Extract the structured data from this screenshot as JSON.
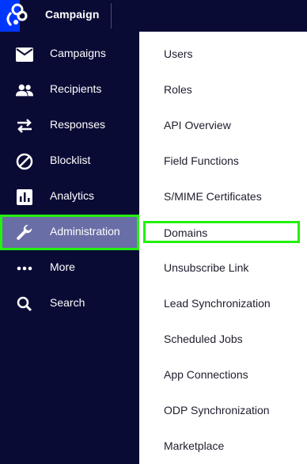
{
  "header": {
    "app_name": "Campaign"
  },
  "sidebar": {
    "items": [
      {
        "label": "Campaigns",
        "icon": "mail-icon"
      },
      {
        "label": "Recipients",
        "icon": "people-icon"
      },
      {
        "label": "Responses",
        "icon": "swap-arrows-icon"
      },
      {
        "label": "Blocklist",
        "icon": "block-icon"
      },
      {
        "label": "Analytics",
        "icon": "bar-chart-icon"
      },
      {
        "label": "Administration",
        "icon": "wrench-icon",
        "active": true
      },
      {
        "label": "More",
        "icon": "more-dots-icon"
      },
      {
        "label": "Search",
        "icon": "search-icon"
      }
    ]
  },
  "submenu": {
    "items": [
      {
        "label": "Users"
      },
      {
        "label": "Roles"
      },
      {
        "label": "API Overview"
      },
      {
        "label": "Field Functions"
      },
      {
        "label": "S/MIME Certificates"
      },
      {
        "label": "Domains",
        "highlighted": true
      },
      {
        "label": "Unsubscribe Link"
      },
      {
        "label": "Lead Synchronization"
      },
      {
        "label": "Scheduled Jobs"
      },
      {
        "label": "App Connections"
      },
      {
        "label": "ODP Synchronization"
      },
      {
        "label": "Marketplace"
      }
    ]
  },
  "colors": {
    "sidebar_bg": "#0a0b35",
    "brand_blue": "#0037ff",
    "active_bg": "#6a6ea6",
    "highlight_border": "#22f20d"
  }
}
